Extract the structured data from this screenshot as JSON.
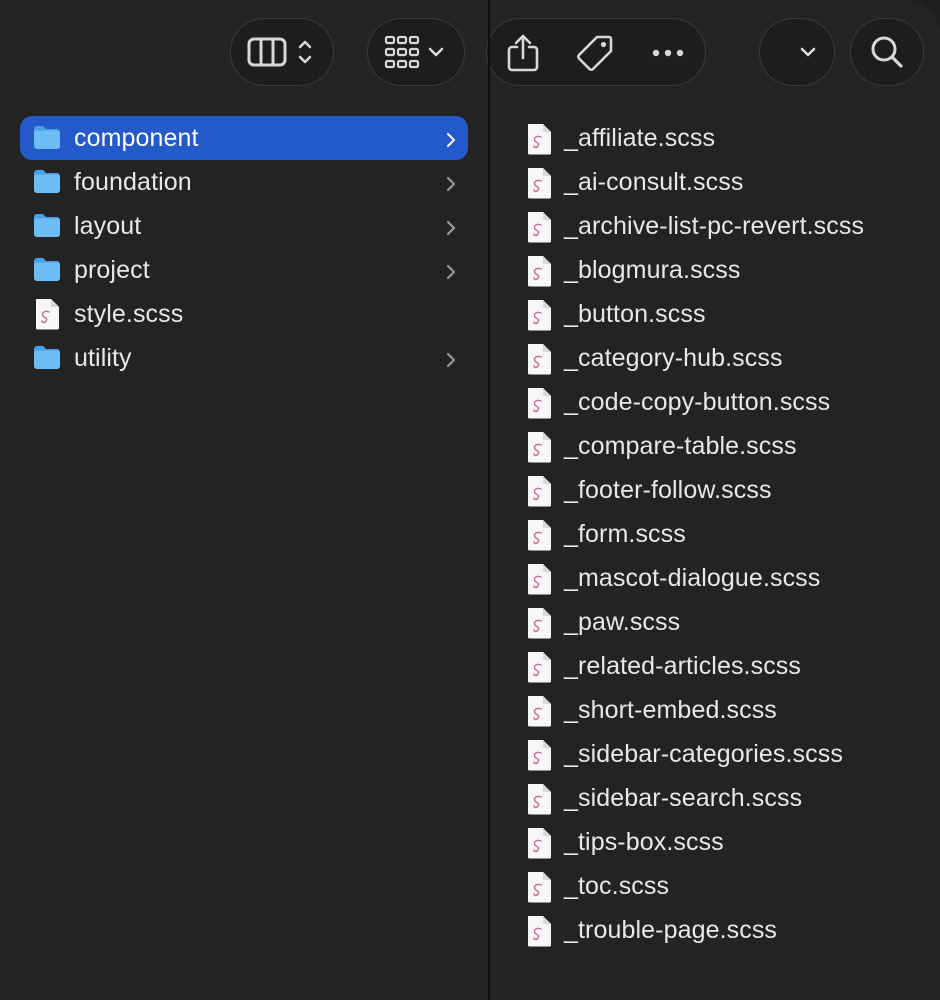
{
  "toolbar": {
    "buttons": [
      {
        "name": "view-columns-button",
        "icon": "columns-view-icon"
      },
      {
        "name": "group-by-button",
        "icon": "grid-icon"
      },
      {
        "name": "share-button",
        "icon": "share-icon"
      },
      {
        "name": "tag-button",
        "icon": "tag-icon"
      },
      {
        "name": "more-button",
        "icon": "ellipsis-icon"
      },
      {
        "name": "dropdown-button",
        "icon": "chevron-down-icon"
      },
      {
        "name": "search-button",
        "icon": "search-icon"
      }
    ]
  },
  "left_column": {
    "items": [
      {
        "label": "component",
        "type": "folder",
        "selected": true,
        "has_children": true
      },
      {
        "label": "foundation",
        "type": "folder",
        "selected": false,
        "has_children": true
      },
      {
        "label": "layout",
        "type": "folder",
        "selected": false,
        "has_children": true
      },
      {
        "label": "project",
        "type": "folder",
        "selected": false,
        "has_children": true
      },
      {
        "label": "style.scss",
        "type": "file",
        "selected": false,
        "has_children": false
      },
      {
        "label": "utility",
        "type": "folder",
        "selected": false,
        "has_children": true
      }
    ]
  },
  "right_column": {
    "items": [
      {
        "label": "_affiliate.scss"
      },
      {
        "label": "_ai-consult.scss"
      },
      {
        "label": "_archive-list-pc-revert.scss"
      },
      {
        "label": "_blogmura.scss"
      },
      {
        "label": "_button.scss"
      },
      {
        "label": "_category-hub.scss"
      },
      {
        "label": "_code-copy-button.scss"
      },
      {
        "label": "_compare-table.scss"
      },
      {
        "label": "_footer-follow.scss"
      },
      {
        "label": "_form.scss"
      },
      {
        "label": "_mascot-dialogue.scss"
      },
      {
        "label": "_paw.scss"
      },
      {
        "label": "_related-articles.scss"
      },
      {
        "label": "_short-embed.scss"
      },
      {
        "label": "_sidebar-categories.scss"
      },
      {
        "label": "_sidebar-search.scss"
      },
      {
        "label": "_tips-box.scss"
      },
      {
        "label": "_toc.scss"
      },
      {
        "label": "_trouble-page.scss"
      }
    ]
  },
  "colors": {
    "background": "#232323",
    "selection": "#2359c8",
    "folder": "#5db1f0",
    "sass_pink": "#cd6799"
  }
}
